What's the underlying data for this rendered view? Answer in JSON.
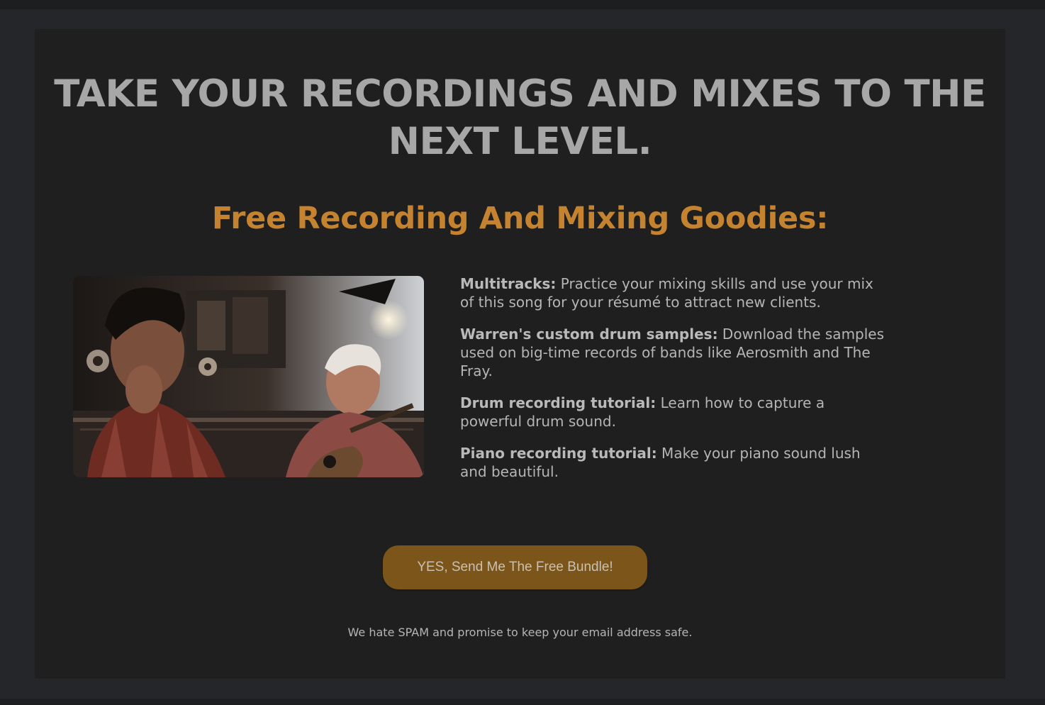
{
  "hero": {
    "headline_line1": "TAKE YOUR RECORDINGS AND MIXES TO THE",
    "headline_line2": "NEXT LEVEL.",
    "subheadline": "Free Recording And Mixing Goodies:"
  },
  "benefits": [
    {
      "lead": "Multitracks:",
      "text": " Practice your mixing skills and use your mix of this song for your résumé to attract new clients."
    },
    {
      "lead": "Warren's custom drum samples:",
      "text": " Download the samples used on big-time records of bands like Aerosmith and The Fray."
    },
    {
      "lead": "Drum recording tutorial:",
      "text": " Learn how to capture a powerful drum sound."
    },
    {
      "lead": "Piano recording tutorial:",
      "text": " Make your piano sound lush and beautiful."
    }
  ],
  "cta": {
    "label": "YES, Send Me The Free Bundle!"
  },
  "fine_print": "We hate SPAM and promise to keep your email address safe.",
  "colors": {
    "page_background": "#25262a",
    "panel_background": "#1f1f20",
    "headline": "#a7a7a7",
    "accent": "#c5832f",
    "button": "#7b5519"
  }
}
